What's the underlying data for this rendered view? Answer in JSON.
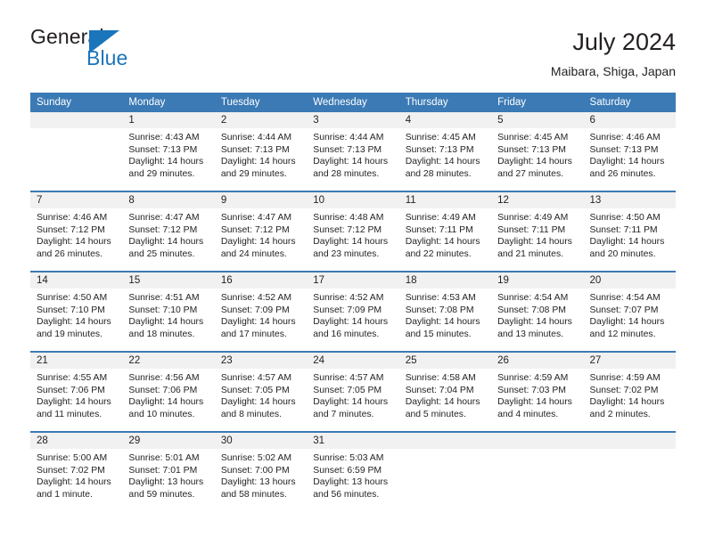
{
  "brand": {
    "name_part1": "General",
    "name_part2": "Blue",
    "logo_icon": "blue-triangle-icon",
    "colors": {
      "dark": "#231f20",
      "blue": "#1b75bb"
    }
  },
  "header": {
    "title": "July 2024",
    "subtitle": "Maibara, Shiga, Japan"
  },
  "calendar": {
    "accent_color": "#3b7ab5",
    "daynum_band_color": "#f1f1f1",
    "weekday_headers": [
      "Sunday",
      "Monday",
      "Tuesday",
      "Wednesday",
      "Thursday",
      "Friday",
      "Saturday"
    ],
    "weeks": [
      [
        {
          "day": "",
          "sunrise": "",
          "sunset": "",
          "daylight_line1": "",
          "daylight_line2": "",
          "empty": true
        },
        {
          "day": "1",
          "sunrise": "Sunrise: 4:43 AM",
          "sunset": "Sunset: 7:13 PM",
          "daylight_line1": "Daylight: 14 hours",
          "daylight_line2": "and 29 minutes."
        },
        {
          "day": "2",
          "sunrise": "Sunrise: 4:44 AM",
          "sunset": "Sunset: 7:13 PM",
          "daylight_line1": "Daylight: 14 hours",
          "daylight_line2": "and 29 minutes."
        },
        {
          "day": "3",
          "sunrise": "Sunrise: 4:44 AM",
          "sunset": "Sunset: 7:13 PM",
          "daylight_line1": "Daylight: 14 hours",
          "daylight_line2": "and 28 minutes."
        },
        {
          "day": "4",
          "sunrise": "Sunrise: 4:45 AM",
          "sunset": "Sunset: 7:13 PM",
          "daylight_line1": "Daylight: 14 hours",
          "daylight_line2": "and 28 minutes."
        },
        {
          "day": "5",
          "sunrise": "Sunrise: 4:45 AM",
          "sunset": "Sunset: 7:13 PM",
          "daylight_line1": "Daylight: 14 hours",
          "daylight_line2": "and 27 minutes."
        },
        {
          "day": "6",
          "sunrise": "Sunrise: 4:46 AM",
          "sunset": "Sunset: 7:13 PM",
          "daylight_line1": "Daylight: 14 hours",
          "daylight_line2": "and 26 minutes."
        }
      ],
      [
        {
          "day": "7",
          "sunrise": "Sunrise: 4:46 AM",
          "sunset": "Sunset: 7:12 PM",
          "daylight_line1": "Daylight: 14 hours",
          "daylight_line2": "and 26 minutes."
        },
        {
          "day": "8",
          "sunrise": "Sunrise: 4:47 AM",
          "sunset": "Sunset: 7:12 PM",
          "daylight_line1": "Daylight: 14 hours",
          "daylight_line2": "and 25 minutes."
        },
        {
          "day": "9",
          "sunrise": "Sunrise: 4:47 AM",
          "sunset": "Sunset: 7:12 PM",
          "daylight_line1": "Daylight: 14 hours",
          "daylight_line2": "and 24 minutes."
        },
        {
          "day": "10",
          "sunrise": "Sunrise: 4:48 AM",
          "sunset": "Sunset: 7:12 PM",
          "daylight_line1": "Daylight: 14 hours",
          "daylight_line2": "and 23 minutes."
        },
        {
          "day": "11",
          "sunrise": "Sunrise: 4:49 AM",
          "sunset": "Sunset: 7:11 PM",
          "daylight_line1": "Daylight: 14 hours",
          "daylight_line2": "and 22 minutes."
        },
        {
          "day": "12",
          "sunrise": "Sunrise: 4:49 AM",
          "sunset": "Sunset: 7:11 PM",
          "daylight_line1": "Daylight: 14 hours",
          "daylight_line2": "and 21 minutes."
        },
        {
          "day": "13",
          "sunrise": "Sunrise: 4:50 AM",
          "sunset": "Sunset: 7:11 PM",
          "daylight_line1": "Daylight: 14 hours",
          "daylight_line2": "and 20 minutes."
        }
      ],
      [
        {
          "day": "14",
          "sunrise": "Sunrise: 4:50 AM",
          "sunset": "Sunset: 7:10 PM",
          "daylight_line1": "Daylight: 14 hours",
          "daylight_line2": "and 19 minutes."
        },
        {
          "day": "15",
          "sunrise": "Sunrise: 4:51 AM",
          "sunset": "Sunset: 7:10 PM",
          "daylight_line1": "Daylight: 14 hours",
          "daylight_line2": "and 18 minutes."
        },
        {
          "day": "16",
          "sunrise": "Sunrise: 4:52 AM",
          "sunset": "Sunset: 7:09 PM",
          "daylight_line1": "Daylight: 14 hours",
          "daylight_line2": "and 17 minutes."
        },
        {
          "day": "17",
          "sunrise": "Sunrise: 4:52 AM",
          "sunset": "Sunset: 7:09 PM",
          "daylight_line1": "Daylight: 14 hours",
          "daylight_line2": "and 16 minutes."
        },
        {
          "day": "18",
          "sunrise": "Sunrise: 4:53 AM",
          "sunset": "Sunset: 7:08 PM",
          "daylight_line1": "Daylight: 14 hours",
          "daylight_line2": "and 15 minutes."
        },
        {
          "day": "19",
          "sunrise": "Sunrise: 4:54 AM",
          "sunset": "Sunset: 7:08 PM",
          "daylight_line1": "Daylight: 14 hours",
          "daylight_line2": "and 13 minutes."
        },
        {
          "day": "20",
          "sunrise": "Sunrise: 4:54 AM",
          "sunset": "Sunset: 7:07 PM",
          "daylight_line1": "Daylight: 14 hours",
          "daylight_line2": "and 12 minutes."
        }
      ],
      [
        {
          "day": "21",
          "sunrise": "Sunrise: 4:55 AM",
          "sunset": "Sunset: 7:06 PM",
          "daylight_line1": "Daylight: 14 hours",
          "daylight_line2": "and 11 minutes."
        },
        {
          "day": "22",
          "sunrise": "Sunrise: 4:56 AM",
          "sunset": "Sunset: 7:06 PM",
          "daylight_line1": "Daylight: 14 hours",
          "daylight_line2": "and 10 minutes."
        },
        {
          "day": "23",
          "sunrise": "Sunrise: 4:57 AM",
          "sunset": "Sunset: 7:05 PM",
          "daylight_line1": "Daylight: 14 hours",
          "daylight_line2": "and 8 minutes."
        },
        {
          "day": "24",
          "sunrise": "Sunrise: 4:57 AM",
          "sunset": "Sunset: 7:05 PM",
          "daylight_line1": "Daylight: 14 hours",
          "daylight_line2": "and 7 minutes."
        },
        {
          "day": "25",
          "sunrise": "Sunrise: 4:58 AM",
          "sunset": "Sunset: 7:04 PM",
          "daylight_line1": "Daylight: 14 hours",
          "daylight_line2": "and 5 minutes."
        },
        {
          "day": "26",
          "sunrise": "Sunrise: 4:59 AM",
          "sunset": "Sunset: 7:03 PM",
          "daylight_line1": "Daylight: 14 hours",
          "daylight_line2": "and 4 minutes."
        },
        {
          "day": "27",
          "sunrise": "Sunrise: 4:59 AM",
          "sunset": "Sunset: 7:02 PM",
          "daylight_line1": "Daylight: 14 hours",
          "daylight_line2": "and 2 minutes."
        }
      ],
      [
        {
          "day": "28",
          "sunrise": "Sunrise: 5:00 AM",
          "sunset": "Sunset: 7:02 PM",
          "daylight_line1": "Daylight: 14 hours",
          "daylight_line2": "and 1 minute."
        },
        {
          "day": "29",
          "sunrise": "Sunrise: 5:01 AM",
          "sunset": "Sunset: 7:01 PM",
          "daylight_line1": "Daylight: 13 hours",
          "daylight_line2": "and 59 minutes."
        },
        {
          "day": "30",
          "sunrise": "Sunrise: 5:02 AM",
          "sunset": "Sunset: 7:00 PM",
          "daylight_line1": "Daylight: 13 hours",
          "daylight_line2": "and 58 minutes."
        },
        {
          "day": "31",
          "sunrise": "Sunrise: 5:03 AM",
          "sunset": "Sunset: 6:59 PM",
          "daylight_line1": "Daylight: 13 hours",
          "daylight_line2": "and 56 minutes."
        },
        {
          "day": "",
          "sunrise": "",
          "sunset": "",
          "daylight_line1": "",
          "daylight_line2": "",
          "empty": true
        },
        {
          "day": "",
          "sunrise": "",
          "sunset": "",
          "daylight_line1": "",
          "daylight_line2": "",
          "empty": true
        },
        {
          "day": "",
          "sunrise": "",
          "sunset": "",
          "daylight_line1": "",
          "daylight_line2": "",
          "empty": true
        }
      ]
    ]
  }
}
